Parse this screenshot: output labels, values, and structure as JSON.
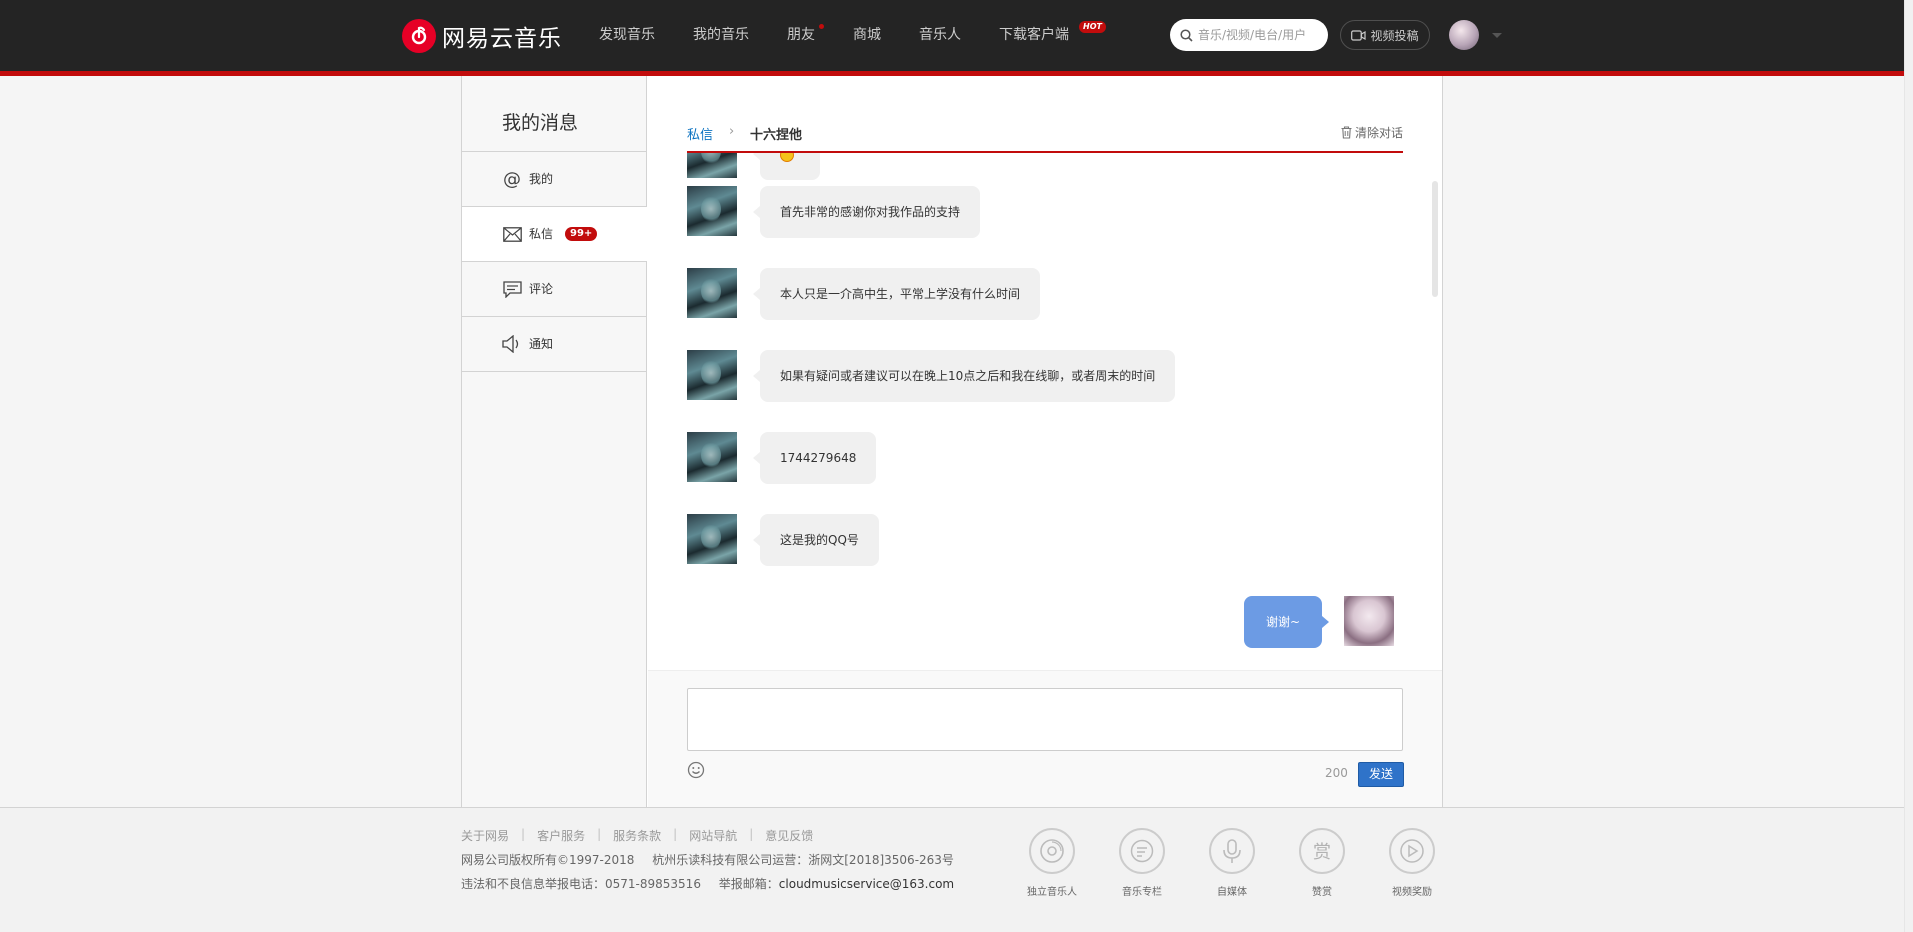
{
  "header": {
    "logo_text": "网易云音乐",
    "nav": [
      "发现音乐",
      "我的音乐",
      "朋友",
      "商城",
      "音乐人",
      "下载客户端"
    ],
    "hot_badge": "HOT",
    "search_placeholder": "音乐/视频/电台/用户",
    "video_button": "视频投稿",
    "accent_color": "#c20c0c"
  },
  "sidebar": {
    "title": "我的消息",
    "items": [
      {
        "label": "我的",
        "icon": "at-icon"
      },
      {
        "label": "私信",
        "icon": "envelope-icon",
        "badge": "99+"
      },
      {
        "label": "评论",
        "icon": "comment-icon"
      },
      {
        "label": "通知",
        "icon": "speaker-icon"
      }
    ]
  },
  "chat": {
    "breadcrumb_link": "私信",
    "breadcrumb_sep": "›",
    "partner_name": "十六捏他",
    "clear_label": "清除对话",
    "messages": [
      {
        "side": "left",
        "text": "首先非常的感谢你对我作品的支持"
      },
      {
        "side": "left",
        "text": "本人只是一介高中生，平常上学没有什么时间"
      },
      {
        "side": "left",
        "text": "如果有疑问或者建议可以在晚上10点之后和我在线聊，或者周末的时间"
      },
      {
        "side": "left",
        "text": "1744279648"
      },
      {
        "side": "left",
        "text": "这是我的QQ号"
      },
      {
        "side": "right",
        "text": "谢谢~"
      }
    ],
    "char_count": "200",
    "send_label": "发送"
  },
  "footer": {
    "links": [
      "关于网易",
      "客户服务",
      "服务条款",
      "网站导航",
      "意见反馈"
    ],
    "copyright": "网易公司版权所有©1997-2018",
    "company": "杭州乐读科技有限公司运营：浙网文[2018]3506-263号",
    "report_phone": "违法和不良信息举报电话：0571-89853516",
    "report_email_label": "举报邮箱：",
    "report_email": "cloudmusicservice@163.com",
    "icons": [
      {
        "label": "独立音乐人",
        "icon": "vinyl-icon"
      },
      {
        "label": "音乐专栏",
        "icon": "list-icon"
      },
      {
        "label": "自媒体",
        "icon": "microphone-icon"
      },
      {
        "label": "赞赏",
        "icon": "reward-icon",
        "glyph": "赏"
      },
      {
        "label": "视频奖励",
        "icon": "video-reward-icon"
      }
    ]
  }
}
